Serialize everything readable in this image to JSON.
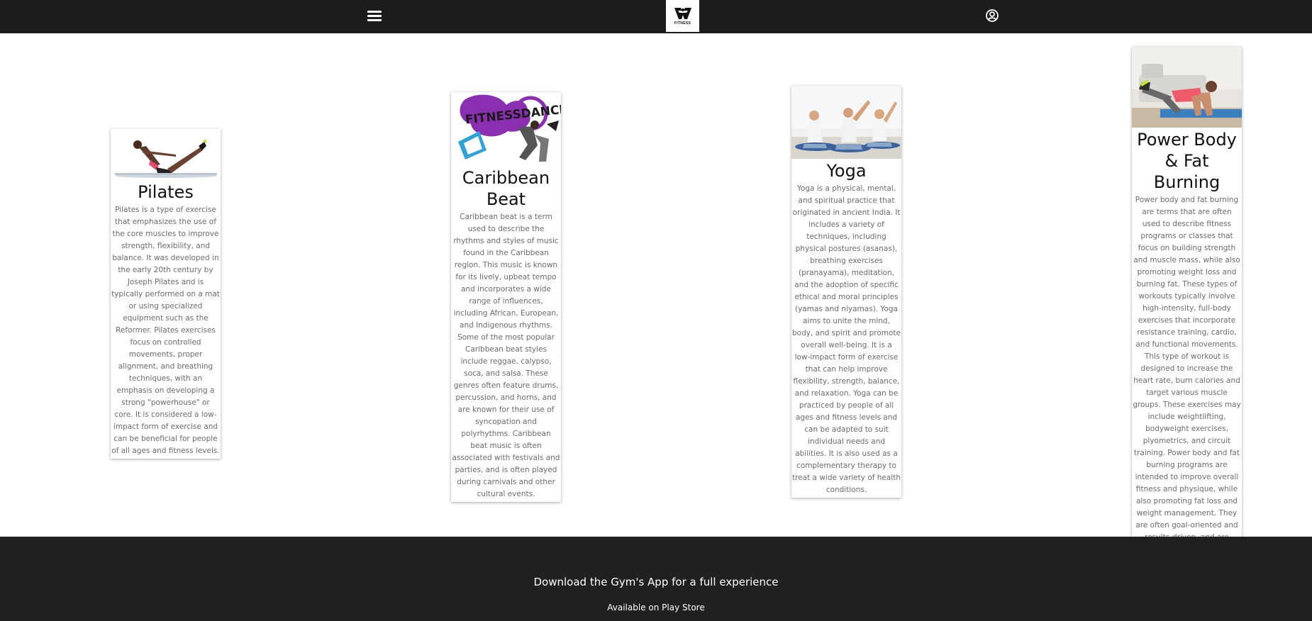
{
  "header": {
    "menu_icon": "hamburger-menu-icon",
    "logo_text": "FITNESS",
    "account_icon": "user-circle-icon"
  },
  "cards": [
    {
      "title": "Pilates",
      "description": "Pilates is a type of exercise that emphasizes the use of the core muscles to improve strength, flexibility, and balance. It was developed in the early 20th century by Joseph Pilates and is typically performed on a mat or using specialized equipment such as the Reformer. Pilates exercises focus on controlled movements, proper alignment, and breathing techniques, with an emphasis on developing a strong \"powerhouse\" or core. It is considered a low-impact form of exercise and can be beneficial for people of all ages and fitness levels."
    },
    {
      "title": "Caribbean Beat",
      "image_text": "FITNESSDANCE",
      "description": "Caribbean beat is a term used to describe the rhythms and styles of music found in the Caribbean region. This music is known for its lively, upbeat tempo and incorporates a wide range of influences, including African, European, and Indigenous rhythms. Some of the most popular Caribbean beat styles include reggae, calypso, soca, and salsa. These genres often feature drums, percussion, and horns, and are known for their use of syncopation and polyrhythms. Caribbean beat music is often associated with festivals and parties, and is often played during carnivals and other cultural events."
    },
    {
      "title": "Yoga",
      "description": "Yoga is a physical, mental, and spiritual practice that originated in ancient India. It includes a variety of techniques, including physical postures (asanas), breathing exercises (pranayama), meditation, and the adoption of specific ethical and moral principles (yamas and niyamas). Yoga aims to unite the mind, body, and spirit and promote overall well-being. It is a low-impact form of exercise that can help improve flexibility, strength, balance, and relaxation. Yoga can be practiced by people of all ages and fitness levels and can be adapted to suit individual needs and abilities. It is also used as a complementary therapy to treat a wide variety of health conditions."
    },
    {
      "title": "Power Body & Fat Burning",
      "description": "Power body and fat burning are terms that are often used to describe fitness programs or classes that focus on building strength and muscle mass, while also promoting weight loss and burning fat. These types of workouts typically involve high-intensity, full-body exercises that incorporate resistance training, cardio, and functional movements. This type of workout is designed to increase the heart rate, burn calories and target various muscle groups. These exercises may include weightlifting, bodyweight exercises, plyometrics, and circuit training. Power body and fat burning programs are intended to improve overall fitness and physique, while also promoting fat loss and weight management. They are often goal-oriented and results-driven, and are suitable for people of all fitness levels."
    }
  ],
  "footer": {
    "title": "Download the Gym's App for a full experience",
    "store_link": "Available on Play Store"
  },
  "colors": {
    "header_bg": "#1c1c1f",
    "footer_bg": "#212121",
    "text_muted": "#6b6b6b"
  }
}
